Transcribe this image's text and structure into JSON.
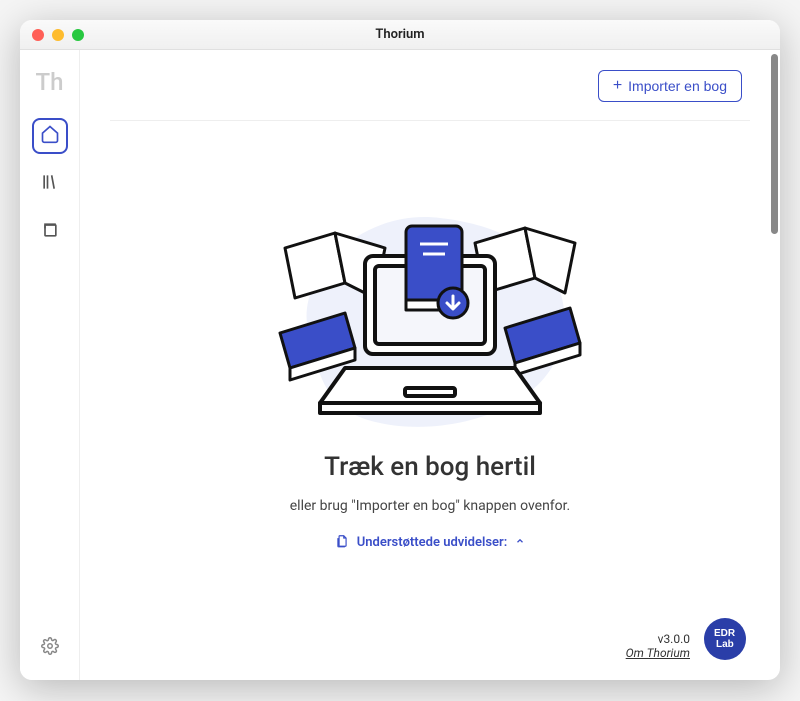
{
  "window": {
    "title": "Thorium"
  },
  "sidebar": {
    "logo": "Th"
  },
  "toolbar": {
    "import_label": "Importer en bog"
  },
  "hero": {
    "headline": "Træk en bog hertil",
    "subline": "eller brug \"Importer en bog\" knappen ovenfor.",
    "extensions_label": "Understøttede udvidelser:"
  },
  "footer": {
    "version": "v3.0.0",
    "about_label": "Om Thorium",
    "badge_text": "EDR Lab"
  }
}
